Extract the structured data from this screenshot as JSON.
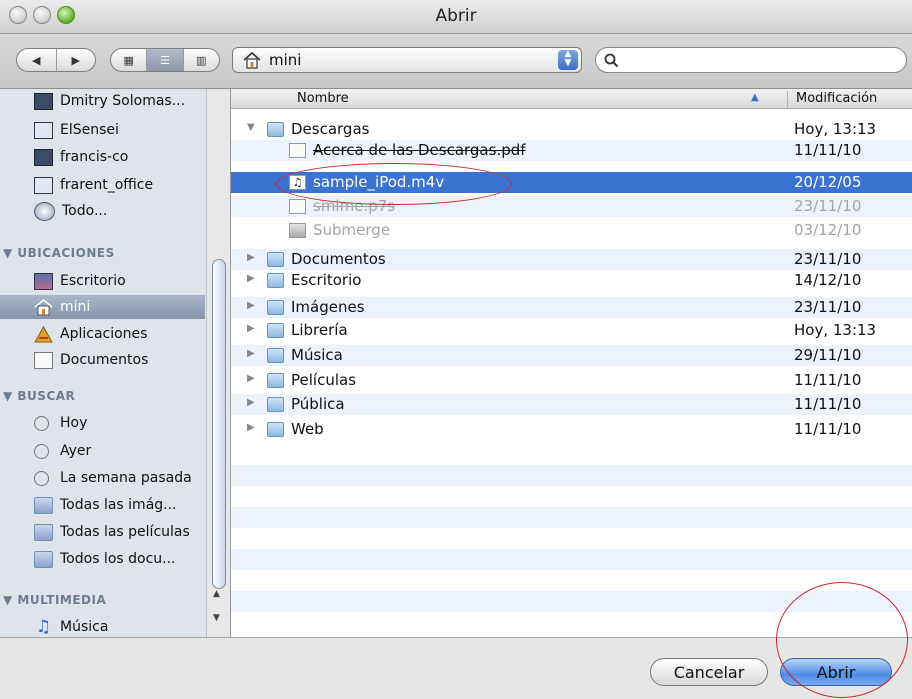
{
  "window": {
    "title": "Abrir"
  },
  "toolbar": {
    "nav": [
      "◀",
      "▶"
    ],
    "views": [
      "▦",
      "☰",
      "▥"
    ],
    "location": "mini"
  },
  "sidebar": {
    "devices": [
      "Dmitry Solomas...",
      "ElSensei",
      "francis-co",
      "frarent_office",
      "Todo..."
    ],
    "places_header": "▼ UBICACIONES",
    "places": [
      "Escritorio",
      "mini",
      "Aplicaciones",
      "Documentos"
    ],
    "search_header": "▼ BUSCAR",
    "search": [
      "Hoy",
      "Ayer",
      "La semana pasada",
      "Todas las imág...",
      "Todas las películas",
      "Todos los docu..."
    ],
    "media_header": "▼ MULTIMEDIA",
    "media": [
      "Música"
    ]
  },
  "list": {
    "col_name": "Nombre",
    "col_date": "Modificación",
    "rows": [
      {
        "name": "Descargas",
        "date": "Hoy, 13:13"
      },
      {
        "name": "Acerca de las Descargas.pdf",
        "date": "11/11/10"
      },
      {
        "name": "sample_iPod.m4v",
        "date": "20/12/05"
      },
      {
        "name": "smime.p7s",
        "date": "23/11/10"
      },
      {
        "name": "Submerge",
        "date": "03/12/10"
      },
      {
        "name": "Documentos",
        "date": "23/11/10"
      },
      {
        "name": "Escritorio",
        "date": "14/12/10"
      },
      {
        "name": "Imágenes",
        "date": "23/11/10"
      },
      {
        "name": "Librería",
        "date": "Hoy, 13:13"
      },
      {
        "name": "Música",
        "date": "29/11/10"
      },
      {
        "name": "Películas",
        "date": "11/11/10"
      },
      {
        "name": "Pública",
        "date": "11/11/10"
      },
      {
        "name": "Web",
        "date": "11/11/10"
      }
    ]
  },
  "buttons": {
    "cancel": "Cancelar",
    "open": "Abrir"
  },
  "colors": {
    "selection": "#3a73d1",
    "sidebar_bg": "#dee4ea",
    "annotation": "#cc2b2b"
  }
}
